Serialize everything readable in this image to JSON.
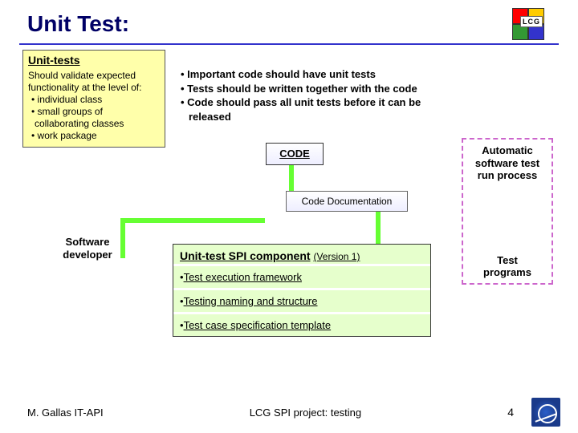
{
  "header": {
    "title": "Unit Test:",
    "logo_label": "LCG"
  },
  "unit_tests_box": {
    "heading": "Unit-tests",
    "intro1": "Should validate expected",
    "intro2": "functionality at the level of:",
    "items": [
      "individual class",
      "small groups of",
      "collaborating classes",
      "work package"
    ]
  },
  "important": {
    "items": [
      "Important code should have unit tests",
      "Tests should be written together with the code",
      "Code should pass all unit tests before it can be",
      "released"
    ]
  },
  "code_label": "CODE",
  "code_doc_label": "Code Documentation",
  "software_developer": {
    "line1": "Software",
    "line2": "developer"
  },
  "spi": {
    "title": "Unit-test SPI component",
    "version": "(Version  1)",
    "items": [
      "Test execution framework",
      "Testing naming and structure",
      "Test case specification template"
    ]
  },
  "automatic": {
    "heading_l1": "Automatic",
    "heading_l2": "software test",
    "heading_l3": "run process",
    "programs_l1": "Test",
    "programs_l2": "programs"
  },
  "footer": {
    "left": "M. Gallas   IT-API",
    "center": "LCG SPI project: testing",
    "page": "4"
  },
  "colors": {
    "title_blue": "#000066",
    "box_yellow": "#ffffaa",
    "spi_green": "#e6ffcc",
    "dash_pink": "#cc66cc",
    "connector_lime": "#66ff33"
  }
}
